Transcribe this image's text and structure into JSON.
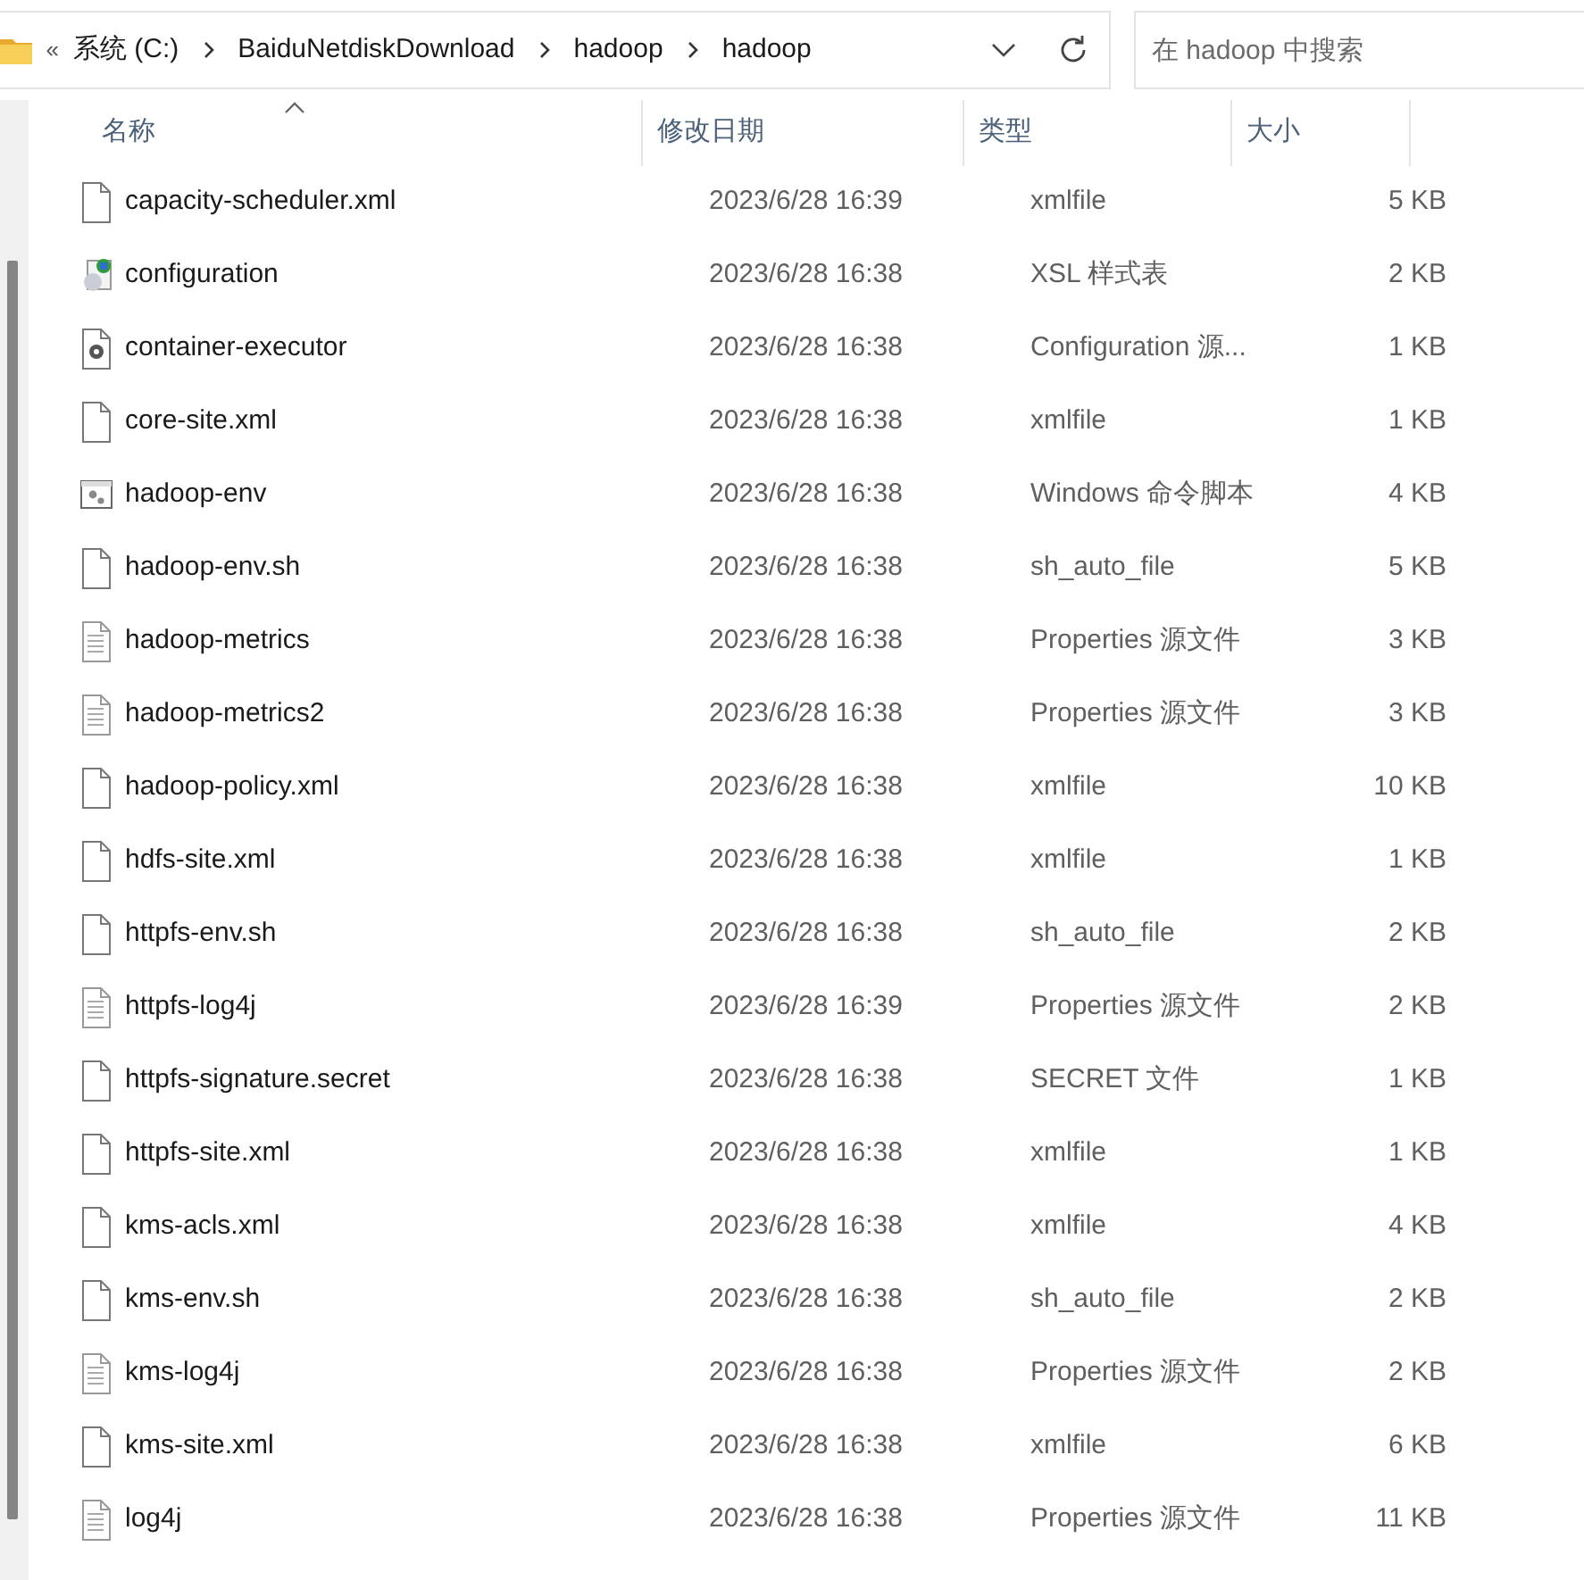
{
  "address_bar": {
    "overflow_glyph": "«",
    "crumbs": [
      "系统 (C:)",
      "BaiduNetdiskDownload",
      "hadoop",
      "hadoop"
    ]
  },
  "search": {
    "placeholder": "在 hadoop 中搜索"
  },
  "table": {
    "columns": [
      {
        "label": "名称",
        "sorted": true
      },
      {
        "label": "修改日期",
        "sorted": false
      },
      {
        "label": "类型",
        "sorted": false
      },
      {
        "label": "大小",
        "sorted": false
      }
    ],
    "rows": [
      {
        "kind": "blank",
        "name": "capacity-scheduler.xml",
        "date": "2023/6/28 16:39",
        "type": "xmlfile",
        "size": "5 KB"
      },
      {
        "kind": "xsl",
        "name": "configuration",
        "date": "2023/6/28 16:38",
        "type": "XSL 样式表",
        "size": "2 KB"
      },
      {
        "kind": "gear",
        "name": "container-executor",
        "date": "2023/6/28 16:38",
        "type": "Configuration 源...",
        "size": "1 KB"
      },
      {
        "kind": "blank",
        "name": "core-site.xml",
        "date": "2023/6/28 16:38",
        "type": "xmlfile",
        "size": "1 KB"
      },
      {
        "kind": "script",
        "name": "hadoop-env",
        "date": "2023/6/28 16:38",
        "type": "Windows 命令脚本",
        "size": "4 KB"
      },
      {
        "kind": "blank",
        "name": "hadoop-env.sh",
        "date": "2023/6/28 16:38",
        "type": "sh_auto_file",
        "size": "5 KB"
      },
      {
        "kind": "text",
        "name": "hadoop-metrics",
        "date": "2023/6/28 16:38",
        "type": "Properties 源文件",
        "size": "3 KB"
      },
      {
        "kind": "text",
        "name": "hadoop-metrics2",
        "date": "2023/6/28 16:38",
        "type": "Properties 源文件",
        "size": "3 KB"
      },
      {
        "kind": "blank",
        "name": "hadoop-policy.xml",
        "date": "2023/6/28 16:38",
        "type": "xmlfile",
        "size": "10 KB"
      },
      {
        "kind": "blank",
        "name": "hdfs-site.xml",
        "date": "2023/6/28 16:38",
        "type": "xmlfile",
        "size": "1 KB"
      },
      {
        "kind": "blank",
        "name": "httpfs-env.sh",
        "date": "2023/6/28 16:38",
        "type": "sh_auto_file",
        "size": "2 KB"
      },
      {
        "kind": "text",
        "name": "httpfs-log4j",
        "date": "2023/6/28 16:39",
        "type": "Properties 源文件",
        "size": "2 KB"
      },
      {
        "kind": "blank",
        "name": "httpfs-signature.secret",
        "date": "2023/6/28 16:38",
        "type": "SECRET 文件",
        "size": "1 KB"
      },
      {
        "kind": "blank",
        "name": "httpfs-site.xml",
        "date": "2023/6/28 16:38",
        "type": "xmlfile",
        "size": "1 KB"
      },
      {
        "kind": "blank",
        "name": "kms-acls.xml",
        "date": "2023/6/28 16:38",
        "type": "xmlfile",
        "size": "4 KB"
      },
      {
        "kind": "blank",
        "name": "kms-env.sh",
        "date": "2023/6/28 16:38",
        "type": "sh_auto_file",
        "size": "2 KB"
      },
      {
        "kind": "text",
        "name": "kms-log4j",
        "date": "2023/6/28 16:38",
        "type": "Properties 源文件",
        "size": "2 KB"
      },
      {
        "kind": "blank",
        "name": "kms-site.xml",
        "date": "2023/6/28 16:38",
        "type": "xmlfile",
        "size": "6 KB"
      },
      {
        "kind": "text",
        "name": "log4j",
        "date": "2023/6/28 16:38",
        "type": "Properties 源文件",
        "size": "11 KB"
      }
    ]
  }
}
